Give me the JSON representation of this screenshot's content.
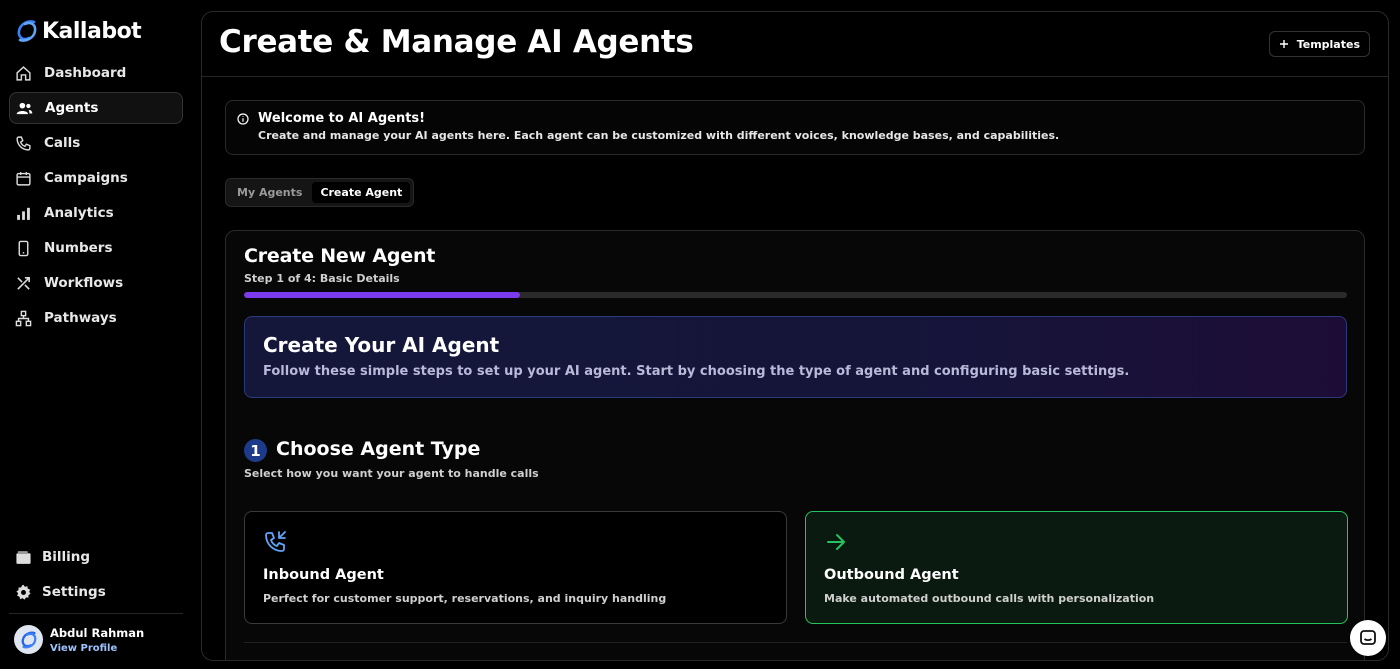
{
  "brand": {
    "name": "Kallabot"
  },
  "sidebar": {
    "items": [
      {
        "label": "Dashboard",
        "icon": "home-icon",
        "active": false
      },
      {
        "label": "Agents",
        "icon": "users-icon",
        "active": true
      },
      {
        "label": "Calls",
        "icon": "phone-icon",
        "active": false
      },
      {
        "label": "Campaigns",
        "icon": "calendar-icon",
        "active": false
      },
      {
        "label": "Analytics",
        "icon": "bar-chart-icon",
        "active": false
      },
      {
        "label": "Numbers",
        "icon": "smartphone-icon",
        "active": false
      },
      {
        "label": "Workflows",
        "icon": "tools-icon",
        "active": false
      },
      {
        "label": "Pathways",
        "icon": "network-icon",
        "active": false
      }
    ],
    "bottom": [
      {
        "label": "Billing",
        "icon": "wallet-icon"
      },
      {
        "label": "Settings",
        "icon": "gear-icon"
      }
    ],
    "profile": {
      "name": "Abdul Rahman",
      "link": "View Profile"
    }
  },
  "header": {
    "title": "Create & Manage AI Agents",
    "templates_label": "Templates"
  },
  "welcome": {
    "title": "Welcome to AI Agents!",
    "description": "Create and manage your AI agents here. Each agent can be customized with different voices, knowledge bases, and capabilities."
  },
  "tabs": [
    {
      "label": "My Agents",
      "active": false
    },
    {
      "label": "Create Agent",
      "active": true
    }
  ],
  "create": {
    "title": "Create New Agent",
    "step_text": "Step 1 of 4: Basic Details",
    "progress": 0.25,
    "banner_title": "Create Your AI Agent",
    "banner_desc": "Follow these simple steps to set up your AI agent. Start by choosing the type of agent and configuring basic settings.",
    "step_number": "1",
    "step_title": "Choose Agent Type",
    "step_sub": "Select how you want your agent to handle calls",
    "options": [
      {
        "title": "Inbound Agent",
        "desc": "Perfect for customer support, reservations, and inquiry handling",
        "icon": "phone-incoming-icon",
        "selected": false
      },
      {
        "title": "Outbound Agent",
        "desc": "Make automated outbound calls with personalization",
        "icon": "arrow-right-icon",
        "selected": true
      }
    ]
  },
  "colors": {
    "accent_purple": "#7c3aed",
    "selected_green": "#22c55e",
    "step_badge": "#1e3a8a"
  }
}
